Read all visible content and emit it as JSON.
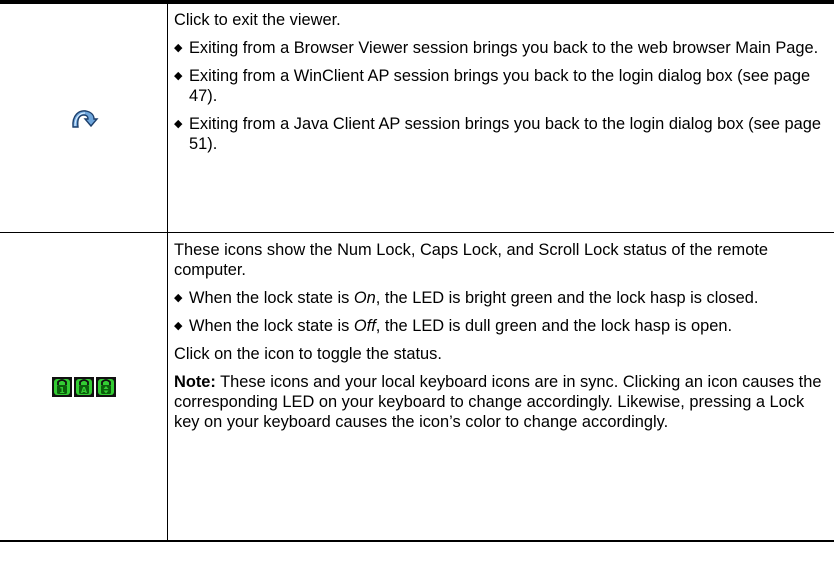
{
  "rows": [
    {
      "icon": "exit-viewer-arrow-icon",
      "intro": "Click to exit the viewer.",
      "bullets": [
        "Exiting from a Browser Viewer session brings you back to the web browser Main Page.",
        "Exiting from a WinClient AP session brings you back to the login dialog box (see page 47).",
        "Exiting from a Java Client AP session brings you back to the login dialog box (see page 51)."
      ]
    },
    {
      "icons": [
        "num-lock-icon",
        "caps-lock-icon",
        "scroll-lock-icon"
      ],
      "intro": "These icons show the Num Lock, Caps Lock, and Scroll Lock status of the remote computer.",
      "bullet_on": {
        "pre": "When the lock state is ",
        "state": "On",
        "post": ", the LED is bright green and the lock hasp is closed."
      },
      "bullet_off": {
        "pre": "When the lock state is ",
        "state": "Off",
        "post": ", the LED is dull green and the lock hasp is open."
      },
      "toggle_text": "Click on the icon to toggle the status.",
      "note_label": "Note:",
      "note_text": " These icons and your local keyboard icons are in sync. Clicking an icon causes the corresponding LED on your keyboard to change accordingly. Likewise, pressing a Lock key on your keyboard causes the icon’s color to change accordingly."
    }
  ],
  "colors": {
    "lock_bg": "#111111",
    "lock_green": "#33cc33",
    "arrow_blue": "#3f7fc6"
  }
}
